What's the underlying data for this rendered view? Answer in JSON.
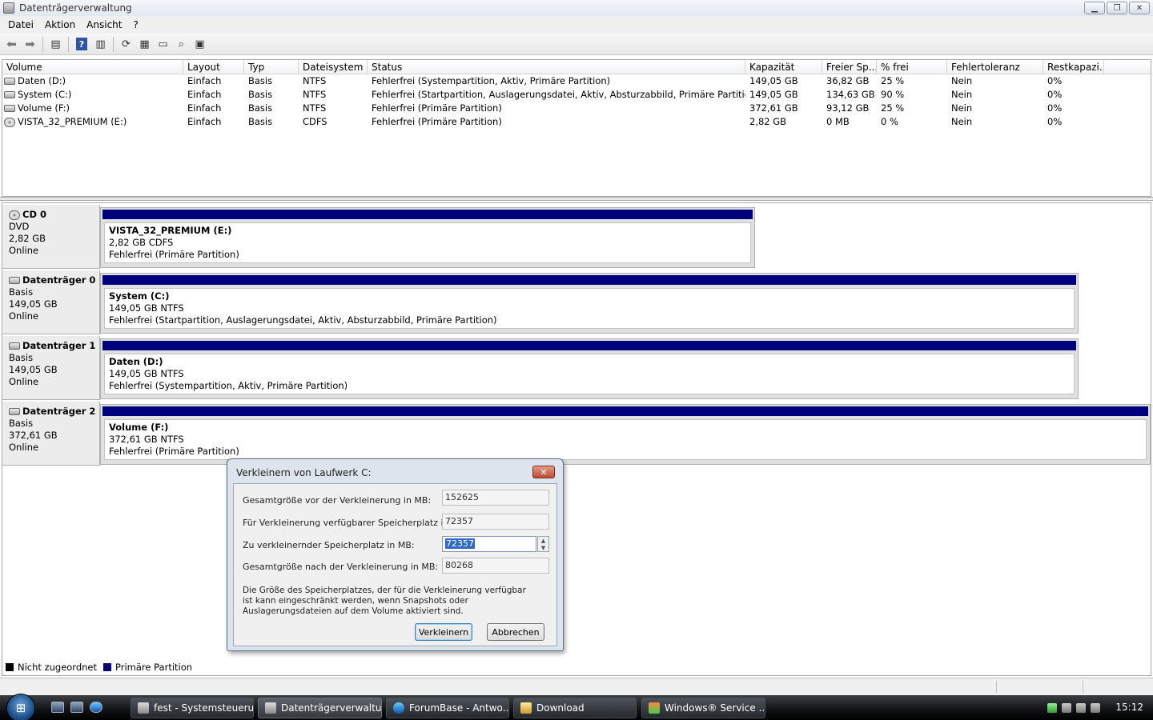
{
  "window": {
    "title": "Datenträgerverwaltung"
  },
  "menu": [
    "Datei",
    "Aktion",
    "Ansicht",
    "?"
  ],
  "volume_table": {
    "columns": [
      "Volume",
      "Layout",
      "Typ",
      "Dateisystem",
      "Status",
      "Kapazität",
      "Freier Sp...",
      "% frei",
      "Fehlertoleranz",
      "Restkapazi..."
    ],
    "rows": [
      {
        "icon": "drive-icon",
        "volume": "Daten (D:)",
        "layout": "Einfach",
        "typ": "Basis",
        "fs": "NTFS",
        "status": "Fehlerfrei (Systempartition, Aktiv, Primäre Partition)",
        "kap": "149,05 GB",
        "frei": "36,82 GB",
        "pct": "25 %",
        "ft": "Nein",
        "rest": "0%"
      },
      {
        "icon": "drive-icon",
        "volume": "System (C:)",
        "layout": "Einfach",
        "typ": "Basis",
        "fs": "NTFS",
        "status": "Fehlerfrei (Startpartition, Auslagerungsdatei, Aktiv, Absturzabbild, Primäre Partition)",
        "kap": "149,05 GB",
        "frei": "134,63 GB",
        "pct": "90 %",
        "ft": "Nein",
        "rest": "0%"
      },
      {
        "icon": "drive-icon",
        "volume": "Volume (F:)",
        "layout": "Einfach",
        "typ": "Basis",
        "fs": "NTFS",
        "status": "Fehlerfrei (Primäre Partition)",
        "kap": "372,61 GB",
        "frei": "93,12 GB",
        "pct": "25 %",
        "ft": "Nein",
        "rest": "0%"
      },
      {
        "icon": "cd-icon",
        "volume": "VISTA_32_PREMIUM (E:)",
        "layout": "Einfach",
        "typ": "Basis",
        "fs": "CDFS",
        "status": "Fehlerfrei (Primäre Partition)",
        "kap": "2,82 GB",
        "frei": "0 MB",
        "pct": "0 %",
        "ft": "Nein",
        "rest": "0%"
      }
    ]
  },
  "disks": [
    {
      "name": "CD 0",
      "type": "DVD",
      "size": "2,82 GB",
      "state": "Online",
      "part_name": "VISTA_32_PREMIUM  (E:)",
      "part_size": "2,82 GB CDFS",
      "part_status": "Fehlerfrei (Primäre Partition)"
    },
    {
      "name": "Datenträger 0",
      "type": "Basis",
      "size": "149,05 GB",
      "state": "Online",
      "part_name": "System  (C:)",
      "part_size": "149,05 GB NTFS",
      "part_status": "Fehlerfrei (Startpartition, Auslagerungsdatei, Aktiv, Absturzabbild, Primäre Partition)"
    },
    {
      "name": "Datenträger 1",
      "type": "Basis",
      "size": "149,05 GB",
      "state": "Online",
      "part_name": "Daten  (D:)",
      "part_size": "149,05 GB NTFS",
      "part_status": "Fehlerfrei (Systempartition, Aktiv, Primäre Partition)"
    },
    {
      "name": "Datenträger 2",
      "type": "Basis",
      "size": "372,61 GB",
      "state": "Online",
      "part_name": "Volume  (F:)",
      "part_size": "372,61 GB NTFS",
      "part_status": "Fehlerfrei (Primäre Partition)"
    }
  ],
  "legend": [
    {
      "label": "Nicht zugeordnet",
      "color": "#000000"
    },
    {
      "label": "Primäre Partition",
      "color": "#00007f"
    }
  ],
  "dialog": {
    "title": "Verkleinern von Laufwerk C:",
    "close": "✕",
    "fields": [
      {
        "label": "Gesamtgröße vor der Verkleinerung in MB:",
        "value": "152625"
      },
      {
        "label": "Für Verkleinerung verfügbarer Speicherplatz in MB:",
        "value": "72357"
      },
      {
        "label": "Zu verkleinernder Speicherplatz in MB:",
        "value": "72357"
      },
      {
        "label": "Gesamtgröße nach der Verkleinerung in MB:",
        "value": "80268"
      }
    ],
    "note": "Die Größe des Speicherplatzes, der für die Verkleinerung verfügbar ist kann eingeschränkt werden, wenn Snapshots oder Auslagerungsdateien auf dem Volume aktiviert sind.",
    "ok": "Verkleinern",
    "cancel": "Abbrechen"
  },
  "taskbar": {
    "tasks": [
      "fest - Systemsteueru...",
      "Datenträgerverwaltu...",
      "ForumBase - Antwo...",
      "Download",
      "Windows® Service ..."
    ],
    "clock": "15:12"
  }
}
